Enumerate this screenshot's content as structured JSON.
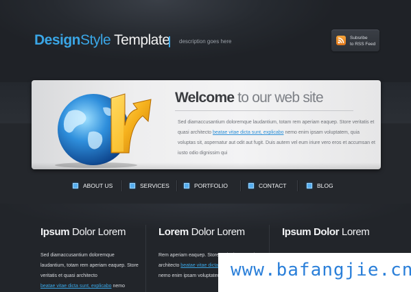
{
  "header": {
    "logo_design": "Design",
    "logo_style": "Style",
    "logo_template": " Template",
    "description": "description goes here",
    "rss": {
      "line1": "Subsribe",
      "line2": "to RSS Feed",
      "icon": "rss-icon"
    }
  },
  "welcome": {
    "title_strong": "Welcome",
    "title_light": " to our web site",
    "body_before": "Sed diamaccusantium doloremque laudantium, totam rem aperiam eaquep. Store veritatis et quasi architecto ",
    "body_link": "beatae vitae dicta sunt, explicabo",
    "body_after": " nemo enim ipsam voluptatem, quia voluptas sit, aspernatur aut odit aut fugit. Duis autem vel eum iriure vero eros et accumsan et iusto odio dignissim qui",
    "art": "globe-with-arrow"
  },
  "nav": {
    "items": [
      {
        "label": "ABOUT US"
      },
      {
        "label": "SERVICES"
      },
      {
        "label": "PORTFOLIO"
      },
      {
        "label": "CONTACT"
      },
      {
        "label": "BLOG"
      }
    ]
  },
  "columns": [
    {
      "title_bold": "Ipsum",
      "title_light": " Dolor Lorem",
      "body_before": "Sed diamaccusantium doloremque laudantium, totam rem aperiam eaquep. Store veritatis et quasi architecto",
      "body_link": "beatae vitae dicta sunt, explicabo",
      "body_after": " nemo"
    },
    {
      "title_bold": "Lorem",
      "title_light": " Dolor Lorem",
      "body_before": "Rem aperiam eaquep. Store veritatis et quasi architecto ",
      "body_link": "beatae vitae dicta sunt, explicabo",
      "body_after": " nemo enim ipsam voluptatem, quia voluptas sit"
    },
    {
      "title_bold": "Ipsum Dolor",
      "title_light": " Lorem"
    }
  ],
  "watermark": "www.bafangjie.cn",
  "colors": {
    "accent": "#3aa6e6",
    "background": "#24272c",
    "panel": "#eeeeef",
    "rss_orange": "#f09a2e"
  }
}
